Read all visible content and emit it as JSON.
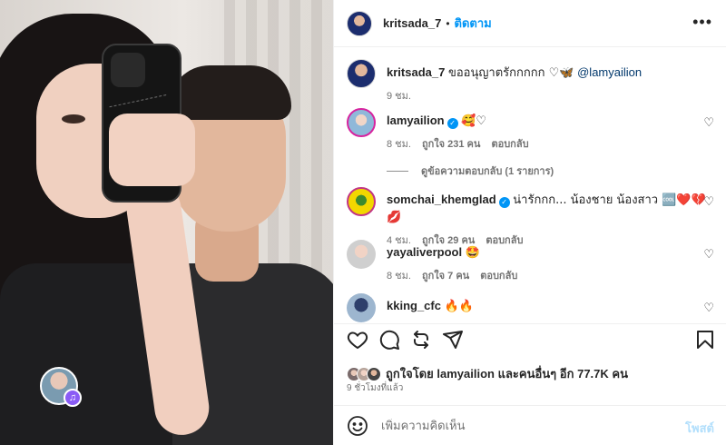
{
  "post": {
    "author": "kritsada_7",
    "follow_label": "ติดตาม",
    "more_label": "•••"
  },
  "caption": {
    "username": "kritsada_7",
    "text": "ขออนุญาตรักกกกก ♡🦋",
    "mention": "@lamyailion",
    "time": "9 ชม."
  },
  "comments": [
    {
      "username": "lamyailion",
      "verified": true,
      "text": "🥰♡",
      "time": "8 ชม.",
      "likes": "ถูกใจ 231 คน",
      "reply": "ตอบกลับ"
    },
    {
      "username": "somchai_khemglad",
      "verified": true,
      "text": "น่ารักกก... น้องชาย น้องสาว 🆒❤️💔💋",
      "time": "4 ชม.",
      "likes": "ถูกใจ 29 คน",
      "reply": "ตอบกลับ"
    },
    {
      "username": "yayaliverpool",
      "verified": false,
      "text": "🤩",
      "time": "8 ชม.",
      "likes": "ถูกใจ 7 คน",
      "reply": "ตอบกลับ"
    },
    {
      "username": "kking_cfc",
      "verified": false,
      "text": "🔥🔥",
      "time": "",
      "likes": "",
      "reply": ""
    }
  ],
  "view_replies": "ดูข้อความตอบกลับ (1 รายการ)",
  "actions": {
    "like_icon": "heart-icon",
    "comment_icon": "comment-icon",
    "share_icon": "repost-icon",
    "send_icon": "send-icon",
    "save_icon": "bookmark-icon"
  },
  "likes_summary": {
    "prefix": "ถูกใจโดย",
    "user": "lamyailion",
    "middle": "และคนอื่นๆ อีก",
    "count": "77.7K",
    "suffix": "คน"
  },
  "posted_ago": "9 ชั่วโมงที่แล้ว",
  "comment_box": {
    "placeholder": "เพิ่มความคิดเห็น",
    "post_label": "โพสต์"
  },
  "colors": {
    "link_blue": "#0095f6",
    "post_disabled": "#b2dffc",
    "mention": "#00376b",
    "muted": "#737373"
  }
}
